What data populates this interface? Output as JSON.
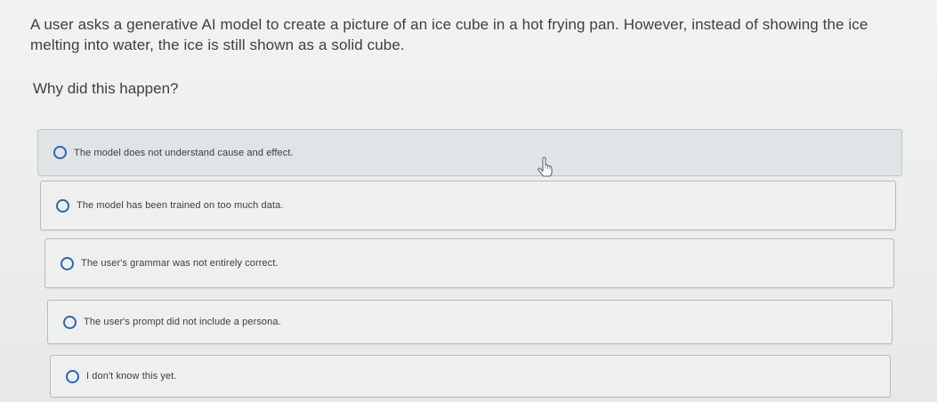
{
  "question": {
    "text": "A user asks a generative AI model to create a picture of an ice cube in a hot frying pan. However, instead of showing the ice melting into water, the ice is still shown as a solid cube.",
    "prompt": "Why did this happen?"
  },
  "options": [
    {
      "label": "The model does not understand cause and effect."
    },
    {
      "label": "The model has been trained on too much data."
    },
    {
      "label": "The user's grammar was not entirely correct."
    },
    {
      "label": "The user's prompt did not include a persona."
    },
    {
      "label": "I don't know this yet."
    }
  ],
  "colors": {
    "radio_border": "#2b64b6",
    "hover_background": "#dfe5e6"
  },
  "icons": {
    "cursor": "hand-pointer-icon"
  }
}
